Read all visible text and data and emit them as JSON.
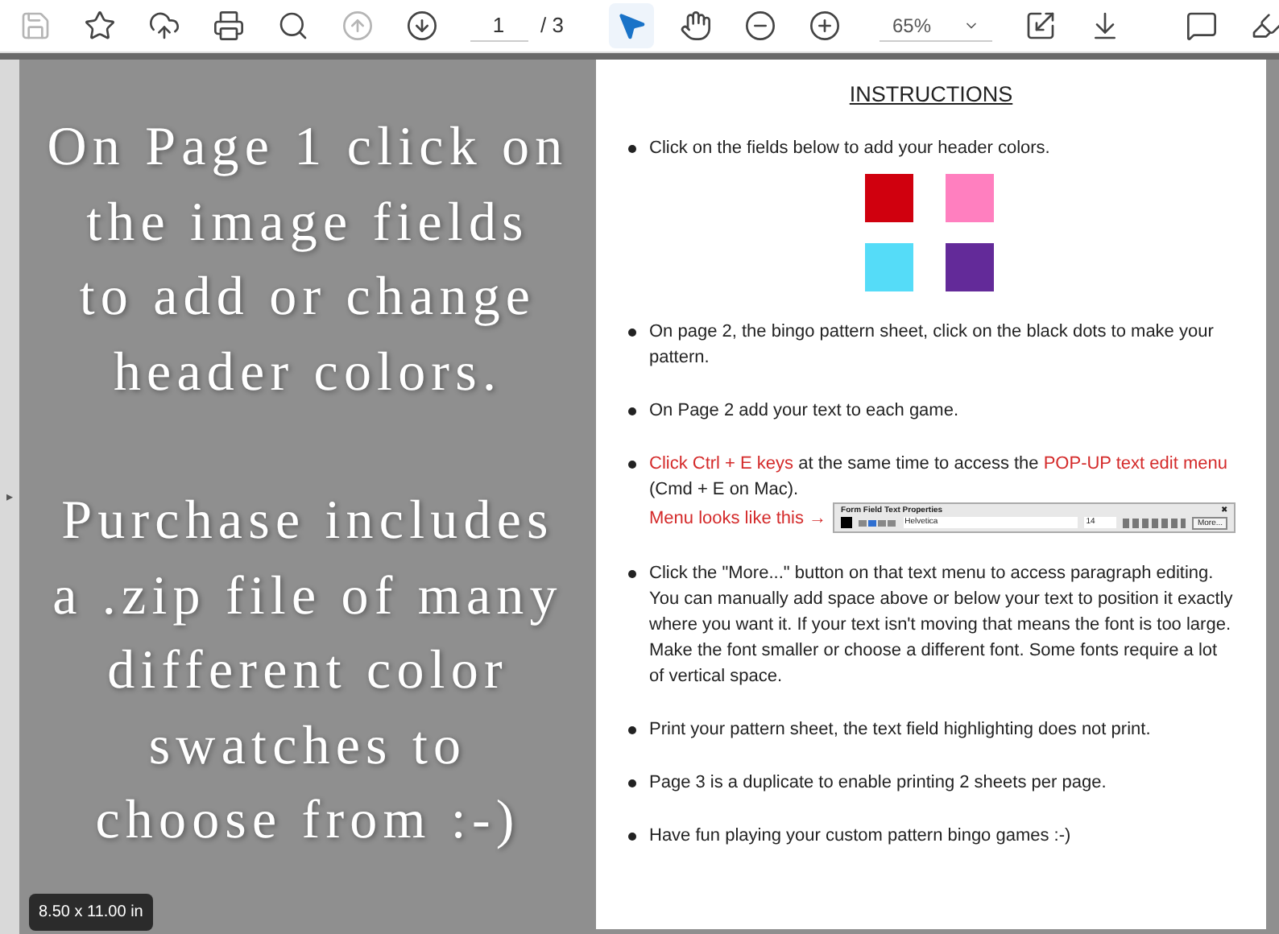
{
  "toolbar": {
    "file_tools": [
      {
        "kind": "save",
        "disabled": true,
        "selected": false
      },
      {
        "kind": "star",
        "disabled": false,
        "selected": false
      },
      {
        "kind": "upload",
        "disabled": false,
        "selected": false
      },
      {
        "kind": "print",
        "disabled": false,
        "selected": false
      },
      {
        "kind": "search",
        "disabled": false,
        "selected": false
      }
    ],
    "nav_tools": [
      {
        "kind": "prev",
        "disabled": true,
        "selected": false
      },
      {
        "kind": "next",
        "disabled": false,
        "selected": false
      }
    ],
    "page_number": "1",
    "page_total": "/ 3",
    "view_tools": [
      {
        "kind": "pointer",
        "disabled": false,
        "selected": true
      },
      {
        "kind": "hand",
        "disabled": false,
        "selected": false
      },
      {
        "kind": "zoomout",
        "disabled": false,
        "selected": false
      },
      {
        "kind": "zoomin",
        "disabled": false,
        "selected": false
      }
    ],
    "zoom": "65%",
    "layout_tools": [
      {
        "kind": "fit",
        "disabled": false,
        "selected": false
      },
      {
        "kind": "scroll",
        "disabled": false,
        "selected": false
      }
    ],
    "annotate_tools": [
      {
        "kind": "comment",
        "disabled": false,
        "selected": false
      },
      {
        "kind": "pen",
        "disabled": false,
        "selected": false
      }
    ]
  },
  "side_panel_toggle": "▸",
  "left_panel": {
    "paragraphs": [
      [
        "On Page 1 click on",
        "the image fields",
        "to add or change",
        "header colors."
      ],
      [
        "Purchase includes",
        "a .zip file of many",
        "different color",
        "swatches to",
        "choose from :-)"
      ]
    ]
  },
  "page_size": "8.50 x 11.00 in",
  "document": {
    "title": "INSTRUCTIONS",
    "items": [
      {
        "segments": [
          {
            "text": "Click on the fields below to add your header colors.",
            "highlight": false
          }
        ],
        "swatches": [
          {
            "color": "#d0000e"
          },
          {
            "color": "#ff7fbf"
          },
          {
            "color": "#55dcf8"
          },
          {
            "color": "#632a99"
          }
        ]
      },
      {
        "segments": [
          {
            "text": "On page 2, the bingo pattern sheet, click on the black dots to make your pattern.",
            "highlight": false
          }
        ]
      },
      {
        "segments": [
          {
            "text": "On Page 2 add your text to each game.",
            "highlight": false
          }
        ]
      },
      {
        "segments": [
          {
            "text": "Click Ctrl + E keys",
            "highlight": true
          },
          {
            "text": " at the same time to access the ",
            "highlight": false
          },
          {
            "text": "POP-UP text edit menu",
            "highlight": true
          },
          {
            "text": " (Cmd + E on Mac).",
            "highlight": false
          }
        ],
        "note": "Menu looks like this →",
        "menu_preview": {
          "title": "Form Field Text Properties",
          "close": "✖",
          "font": "Helvetica",
          "size": "14",
          "button": "More..."
        }
      },
      {
        "segments": [
          {
            "text": "Click the \"More...\" button on that text menu to access paragraph editing. You can manually add space above or below your text to position it exactly where you want it. If your text isn't moving that means the font is too large. Make the font smaller or choose a different font. Some fonts require a lot of vertical space.",
            "highlight": false
          }
        ]
      },
      {
        "segments": [
          {
            "text": "Print your pattern sheet, the text field highlighting does not print.",
            "highlight": false
          }
        ]
      },
      {
        "segments": [
          {
            "text": "Page 3 is a duplicate to enable printing 2 sheets per page.",
            "highlight": false
          }
        ]
      },
      {
        "segments": [
          {
            "text": "Have fun playing your custom pattern bingo games :-)",
            "highlight": false
          }
        ]
      }
    ]
  }
}
